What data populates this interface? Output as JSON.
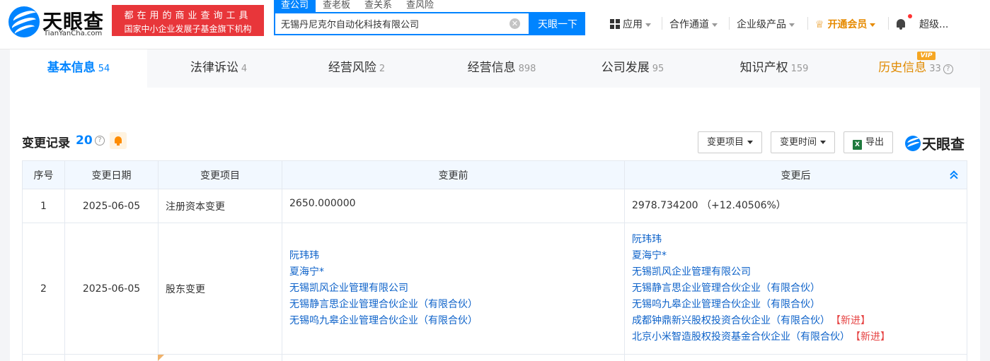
{
  "header": {
    "logo_text": "天眼查",
    "logo_sub": "TianYanCha.com",
    "promo_line1": "都在用的商业查询工具",
    "promo_line2": "国家中小企业发展子基金旗下机构",
    "search_tabs": [
      "查公司",
      "查老板",
      "查关系",
      "查风险"
    ],
    "search_value": "无锡丹尼克尔自动化科技有限公司",
    "clear_symbol": "✕",
    "search_button": "天眼一下",
    "nav": {
      "apps": "应用",
      "channel": "合作通道",
      "enterprise": "企业级产品",
      "vip": "开通会员",
      "user": "超级..."
    }
  },
  "tabs": [
    {
      "label": "基本信息",
      "count": "54"
    },
    {
      "label": "法律诉讼",
      "count": "4"
    },
    {
      "label": "经营风险",
      "count": "2"
    },
    {
      "label": "经营信息",
      "count": "898"
    },
    {
      "label": "公司发展",
      "count": "95"
    },
    {
      "label": "知识产权",
      "count": "159"
    },
    {
      "label": "历史信息",
      "count": "33"
    }
  ],
  "vip_badge": "VIP",
  "section": {
    "title": "变更记录",
    "count": "20",
    "filter_item": "变更项目",
    "filter_time": "变更时间",
    "export": "导出",
    "watermark": "天眼查"
  },
  "table": {
    "headers": [
      "序号",
      "变更日期",
      "变更项目",
      "变更前",
      "变更后"
    ],
    "rows": [
      {
        "index": "1",
        "date": "2025-06-05",
        "item": "注册资本变更",
        "before": "2650.000000",
        "after": "2978.734200 （+12.40506%）"
      },
      {
        "index": "2",
        "date": "2025-06-05",
        "item": "股东变更",
        "before": [
          "阮玮玮",
          "夏海宁*",
          "无锡凯风企业管理有限公司",
          "无锡静言思企业管理合伙企业（有限合伙）",
          "无锡呜九皋企业管理合伙企业（有限合伙）"
        ],
        "after": [
          "阮玮玮",
          "夏海宁*",
          "无锡凯风企业管理有限公司",
          "无锡静言思企业管理合伙企业（有限合伙）",
          "无锡呜九皋企业管理合伙企业（有限合伙）",
          "成都钟鼎新兴股权投资合伙企业（有限合伙）",
          "北京小米智造股权投资基金合伙企业（有限合伙）"
        ],
        "new_tag": "【新进】"
      }
    ]
  },
  "colors": {
    "accent": "#0084ff",
    "promo_red": "#e8363a",
    "vip_orange": "#e68a00",
    "new_red": "#e64545",
    "link_blue": "#0d62c9"
  }
}
